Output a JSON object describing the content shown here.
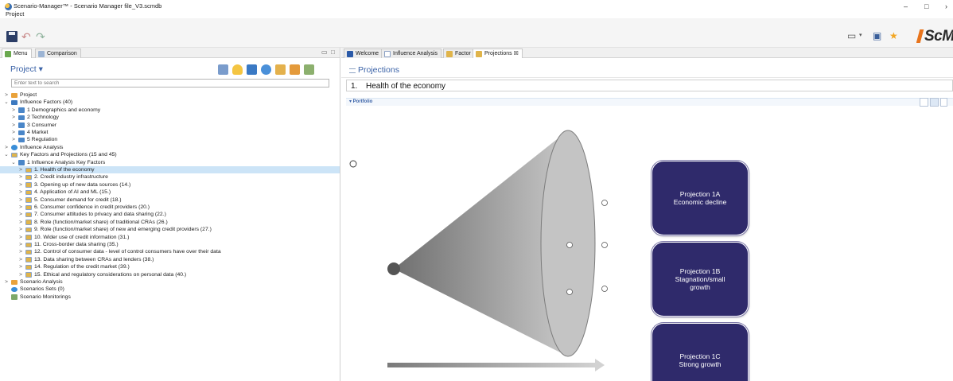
{
  "window": {
    "title": "Scenario-Manager™ - Scenario Manager file_V3.scmdb",
    "menu_project": "Project",
    "minimize": "–",
    "maximize": "□",
    "more": "›"
  },
  "toolbar": {
    "logo_text": "ScM"
  },
  "left_panel": {
    "tabs": [
      {
        "label": "Menu",
        "icon": "menu-icon"
      },
      {
        "label": "Comparison",
        "icon": "comparison-icon"
      }
    ],
    "title": "Project ▾",
    "search_placeholder": "Enter text to search",
    "tree": [
      {
        "label": "Project",
        "chevron": ">",
        "icon": "proj"
      },
      {
        "label": "Influence Factors (40)",
        "chevron": "⌄",
        "icon": "blue"
      },
      {
        "label": "1 Demographics and economy",
        "chevron": ">",
        "icon": "folder"
      },
      {
        "label": "2 Technology",
        "chevron": ">",
        "icon": "folder"
      },
      {
        "label": "3 Consumer",
        "chevron": ">",
        "icon": "folder"
      },
      {
        "label": "4 Market",
        "chevron": ">",
        "icon": "folder"
      },
      {
        "label": "5 Regulation",
        "chevron": ">",
        "icon": "folder"
      },
      {
        "label": "Influence Analysis",
        "chevron": ">",
        "icon": "round"
      },
      {
        "label": "Key Factors and Projections (15 and 45)",
        "chevron": "⌄",
        "icon": "kf"
      },
      {
        "label": "1 Influence Analysis Key Factors",
        "chevron": "⌄",
        "icon": "folder"
      },
      {
        "label": "1. Health of the economy",
        "chevron": ">",
        "icon": "kf"
      },
      {
        "label": "2. Credit industry infrastructure",
        "chevron": ">",
        "icon": "kf"
      },
      {
        "label": "3. Opening up of new data sources (14.)",
        "chevron": ">",
        "icon": "kf"
      },
      {
        "label": "4. Application of AI and ML (15.)",
        "chevron": ">",
        "icon": "kf"
      },
      {
        "label": "5. Consumer demand for credit (18.)",
        "chevron": ">",
        "icon": "kf"
      },
      {
        "label": "6. Consumer confidence in credit providers (20.)",
        "chevron": ">",
        "icon": "kf"
      },
      {
        "label": "7. Consumer attitudes to privacy and data sharing (22.)",
        "chevron": ">",
        "icon": "kf"
      },
      {
        "label": "8. Role (function/market share) of traditional CRAs (26.)",
        "chevron": ">",
        "icon": "kf"
      },
      {
        "label": "9. Role (function/market share) of new and emerging credit providers (27.)",
        "chevron": ">",
        "icon": "kf"
      },
      {
        "label": "10. Wider use of credit information (31.)",
        "chevron": ">",
        "icon": "kf"
      },
      {
        "label": "11. Cross-border data sharing (35.)",
        "chevron": ">",
        "icon": "kf"
      },
      {
        "label": "12. Control of consumer data - level of control consumers have over their data",
        "chevron": ">",
        "icon": "kf"
      },
      {
        "label": "13. Data sharing between CRAs and lenders (38.)",
        "chevron": ">",
        "icon": "kf"
      },
      {
        "label": "14. Regulation of the credit market (39.)",
        "chevron": ">",
        "icon": "kf"
      },
      {
        "label": "15. Ethical and regulatory considerations on personal data (40.)",
        "chevron": ">",
        "icon": "kf"
      },
      {
        "label": "Scenario Analysis",
        "chevron": ">",
        "icon": "proj"
      },
      {
        "label": "Scenarios Sets (0)",
        "chevron": "",
        "icon": "round"
      },
      {
        "label": "Scenario Monitorings",
        "chevron": "",
        "icon": "mon"
      }
    ],
    "selected_index": 10
  },
  "editor": {
    "tabs": [
      {
        "label": "Welcome",
        "icon": "welcome-icon"
      },
      {
        "label": "Influence Analysis",
        "icon": "influence-analysis-icon"
      },
      {
        "label": "Factor",
        "icon": "factor-icon"
      },
      {
        "label": "Projections ☒",
        "icon": "projections-icon"
      }
    ],
    "title": "Projections",
    "key_factor_number": "1.",
    "key_factor_name": "Health of the economy",
    "portfolio_label": "▾ Portfolio",
    "projections": [
      {
        "line1": "Projection 1A",
        "line2": "Economic decline",
        "line3": ""
      },
      {
        "line1": "Projection 1B",
        "line2": "Stagnation/small",
        "line3": "growth"
      },
      {
        "line1": "Projection 1C",
        "line2": "Strong growth",
        "line3": ""
      }
    ],
    "colors": {
      "projection_box": "#2f2a6b",
      "title_blue": "#3a62a7",
      "selection": "#cce4f7"
    }
  }
}
